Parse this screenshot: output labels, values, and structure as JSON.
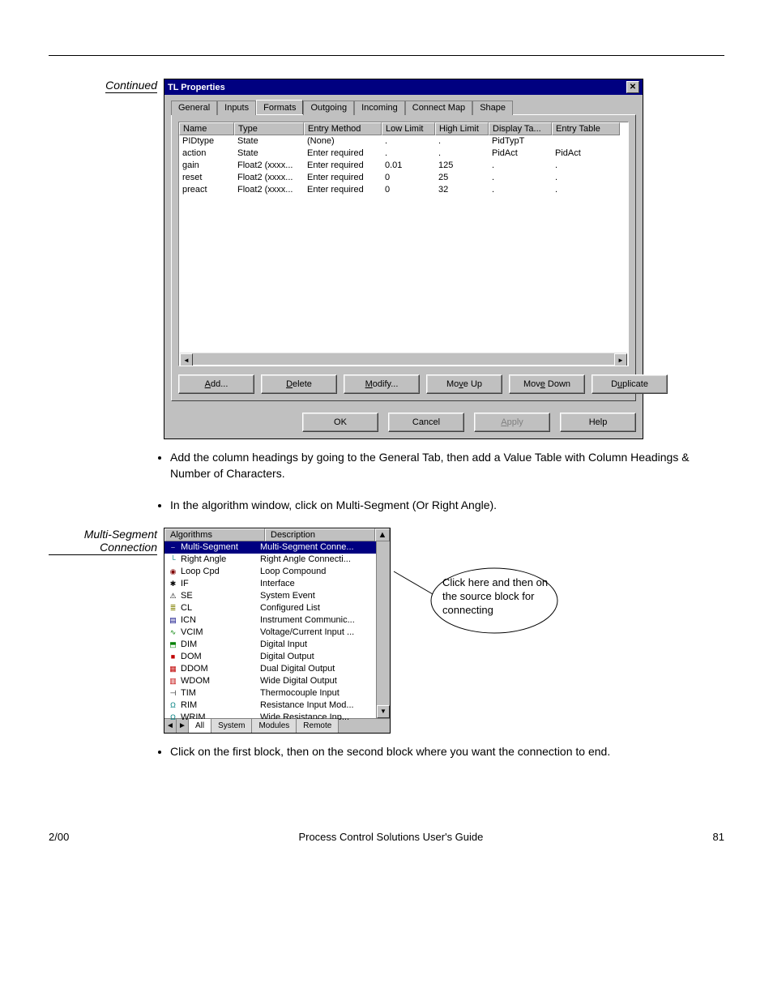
{
  "header_section": "Continued",
  "dialog": {
    "title": "TL Properties",
    "tabs": [
      "General",
      "Inputs",
      "Formats",
      "Outgoing",
      "Incoming",
      "Connect Map",
      "Shape"
    ],
    "active_tab": 2,
    "columns": [
      "Name",
      "Type",
      "Entry Method",
      "Low Limit",
      "High Limit",
      "Display Ta...",
      "Entry Table"
    ],
    "rows": [
      {
        "name": "PIDtype",
        "type": "State",
        "entry": "(None)",
        "low": ".",
        "high": ".",
        "disp": "PidTypT",
        "etab": ""
      },
      {
        "name": "action",
        "type": "State",
        "entry": "Enter required",
        "low": ".",
        "high": ".",
        "disp": "PidAct",
        "etab": "PidAct"
      },
      {
        "name": "gain",
        "type": "Float2 (xxxx...",
        "entry": "Enter required",
        "low": "0.01",
        "high": "125",
        "disp": ".",
        "etab": "."
      },
      {
        "name": "reset",
        "type": "Float2 (xxxx...",
        "entry": "Enter required",
        "low": "0",
        "high": "25",
        "disp": ".",
        "etab": "."
      },
      {
        "name": "preact",
        "type": "Float2 (xxxx...",
        "entry": "Enter required",
        "low": "0",
        "high": "32",
        "disp": ".",
        "etab": "."
      }
    ],
    "row_buttons": {
      "add": "Add...",
      "delete": "Delete",
      "modify": "Modify...",
      "moveup": "Move Up",
      "movedown": "Move Down",
      "duplicate": "Duplicate"
    },
    "dlg_buttons": {
      "ok": "OK",
      "cancel": "Cancel",
      "apply": "Apply",
      "help": "Help"
    }
  },
  "bullets_a": [
    "Add the column headings by going to the General Tab, then add a Value Table with Column Headings & Number of Characters.",
    "In the algorithm window, click on Multi-Segment (Or Right Angle)."
  ],
  "side_label_2": "Multi-Segment Connection",
  "algo": {
    "columns": [
      "Algorithms",
      "Description"
    ],
    "rows": [
      {
        "icon": "line-icon",
        "name": "Multi-Segment",
        "desc": "Multi-Segment Conne...",
        "selected": true
      },
      {
        "icon": "angle-icon",
        "name": "Right Angle",
        "desc": "Right Angle Connecti..."
      },
      {
        "icon": "loop-icon",
        "name": "Loop Cpd",
        "desc": "Loop Compound"
      },
      {
        "icon": "gear-icon",
        "name": "IF",
        "desc": "Interface"
      },
      {
        "icon": "alarm-icon",
        "name": "SE",
        "desc": "System Event"
      },
      {
        "icon": "list-icon",
        "name": "CL",
        "desc": "Configured List"
      },
      {
        "icon": "device-icon",
        "name": "ICN",
        "desc": "Instrument Communic..."
      },
      {
        "icon": "vcim-icon",
        "name": "VCIM",
        "desc": "Voltage/Current Input ..."
      },
      {
        "icon": "dim-icon",
        "name": "DIM",
        "desc": "Digital Input"
      },
      {
        "icon": "dom-icon",
        "name": "DOM",
        "desc": "Digital Output"
      },
      {
        "icon": "ddom-icon",
        "name": "DDOM",
        "desc": "Dual Digital Output"
      },
      {
        "icon": "wdom-icon",
        "name": "WDOM",
        "desc": "Wide Digital Output"
      },
      {
        "icon": "tim-icon",
        "name": "TIM",
        "desc": "Thermocouple Input"
      },
      {
        "icon": "rim-icon",
        "name": "RIM",
        "desc": "Resistance Input Mod..."
      },
      {
        "icon": "wrim-icon",
        "name": "WRIM",
        "desc": "Wide Resistance Inp..."
      }
    ],
    "tabs": [
      "All",
      "System",
      "Modules",
      "Remote"
    ]
  },
  "callout": "Click here and then on the source block for connecting",
  "bullets_b": [
    "Click on the first block, then on the second block where you want the connection to end."
  ],
  "footer": {
    "left": "2/00",
    "center": "Process Control Solutions User's Guide",
    "right": "81"
  }
}
